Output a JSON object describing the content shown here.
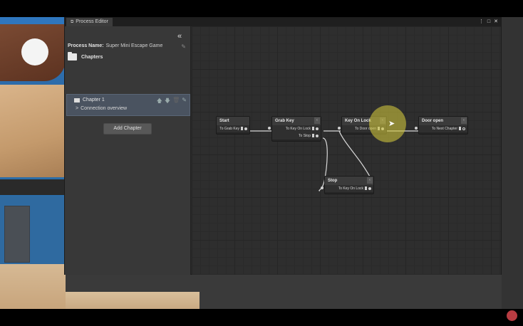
{
  "window": {
    "tab_label": "Process Editor",
    "tab_icon": "process-editor-icon",
    "controls": [
      "⋮",
      "□",
      "✕"
    ]
  },
  "sidebar": {
    "collapse_icon": "«",
    "process_name_label": "Process Name:",
    "process_name_value": "Super Mini Escape Game",
    "chapters_label": "Chapters",
    "chapter": {
      "title": "Chapter 1",
      "connection_label": "Connection overview",
      "connection_chevron": ">"
    },
    "add_chapter_label": "Add Chapter"
  },
  "graph": {
    "nodes": {
      "start": {
        "title": "Start",
        "transitions": [
          "To Grab Key"
        ]
      },
      "grab_key": {
        "title": "Grab Key",
        "transitions": [
          "To Key On Lock",
          "To Stop"
        ]
      },
      "key_on_lock": {
        "title": "Key On Lock",
        "transitions": [
          "To Door open"
        ]
      },
      "door_open": {
        "title": "Door open",
        "transitions": [
          "To Next Chapter"
        ]
      },
      "stop": {
        "title": "Stop",
        "transitions": [
          "To Key On Lock"
        ]
      }
    }
  },
  "colors": {
    "accent_chapter": "#4a5360",
    "cursor_highlight": "#cdc33c"
  }
}
